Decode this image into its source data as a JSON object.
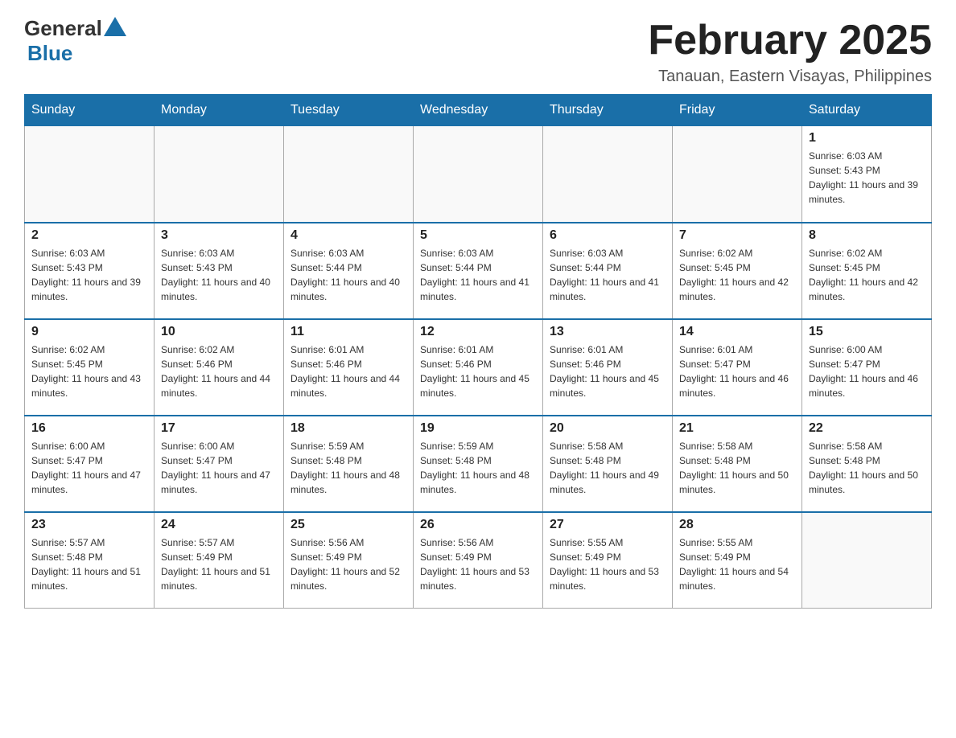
{
  "header": {
    "logo_general": "General",
    "logo_blue": "Blue",
    "title": "February 2025",
    "location": "Tanauan, Eastern Visayas, Philippines"
  },
  "weekdays": [
    "Sunday",
    "Monday",
    "Tuesday",
    "Wednesday",
    "Thursday",
    "Friday",
    "Saturday"
  ],
  "weeks": [
    [
      {
        "day": "",
        "sunrise": "",
        "sunset": "",
        "daylight": ""
      },
      {
        "day": "",
        "sunrise": "",
        "sunset": "",
        "daylight": ""
      },
      {
        "day": "",
        "sunrise": "",
        "sunset": "",
        "daylight": ""
      },
      {
        "day": "",
        "sunrise": "",
        "sunset": "",
        "daylight": ""
      },
      {
        "day": "",
        "sunrise": "",
        "sunset": "",
        "daylight": ""
      },
      {
        "day": "",
        "sunrise": "",
        "sunset": "",
        "daylight": ""
      },
      {
        "day": "1",
        "sunrise": "Sunrise: 6:03 AM",
        "sunset": "Sunset: 5:43 PM",
        "daylight": "Daylight: 11 hours and 39 minutes."
      }
    ],
    [
      {
        "day": "2",
        "sunrise": "Sunrise: 6:03 AM",
        "sunset": "Sunset: 5:43 PM",
        "daylight": "Daylight: 11 hours and 39 minutes."
      },
      {
        "day": "3",
        "sunrise": "Sunrise: 6:03 AM",
        "sunset": "Sunset: 5:43 PM",
        "daylight": "Daylight: 11 hours and 40 minutes."
      },
      {
        "day": "4",
        "sunrise": "Sunrise: 6:03 AM",
        "sunset": "Sunset: 5:44 PM",
        "daylight": "Daylight: 11 hours and 40 minutes."
      },
      {
        "day": "5",
        "sunrise": "Sunrise: 6:03 AM",
        "sunset": "Sunset: 5:44 PM",
        "daylight": "Daylight: 11 hours and 41 minutes."
      },
      {
        "day": "6",
        "sunrise": "Sunrise: 6:03 AM",
        "sunset": "Sunset: 5:44 PM",
        "daylight": "Daylight: 11 hours and 41 minutes."
      },
      {
        "day": "7",
        "sunrise": "Sunrise: 6:02 AM",
        "sunset": "Sunset: 5:45 PM",
        "daylight": "Daylight: 11 hours and 42 minutes."
      },
      {
        "day": "8",
        "sunrise": "Sunrise: 6:02 AM",
        "sunset": "Sunset: 5:45 PM",
        "daylight": "Daylight: 11 hours and 42 minutes."
      }
    ],
    [
      {
        "day": "9",
        "sunrise": "Sunrise: 6:02 AM",
        "sunset": "Sunset: 5:45 PM",
        "daylight": "Daylight: 11 hours and 43 minutes."
      },
      {
        "day": "10",
        "sunrise": "Sunrise: 6:02 AM",
        "sunset": "Sunset: 5:46 PM",
        "daylight": "Daylight: 11 hours and 44 minutes."
      },
      {
        "day": "11",
        "sunrise": "Sunrise: 6:01 AM",
        "sunset": "Sunset: 5:46 PM",
        "daylight": "Daylight: 11 hours and 44 minutes."
      },
      {
        "day": "12",
        "sunrise": "Sunrise: 6:01 AM",
        "sunset": "Sunset: 5:46 PM",
        "daylight": "Daylight: 11 hours and 45 minutes."
      },
      {
        "day": "13",
        "sunrise": "Sunrise: 6:01 AM",
        "sunset": "Sunset: 5:46 PM",
        "daylight": "Daylight: 11 hours and 45 minutes."
      },
      {
        "day": "14",
        "sunrise": "Sunrise: 6:01 AM",
        "sunset": "Sunset: 5:47 PM",
        "daylight": "Daylight: 11 hours and 46 minutes."
      },
      {
        "day": "15",
        "sunrise": "Sunrise: 6:00 AM",
        "sunset": "Sunset: 5:47 PM",
        "daylight": "Daylight: 11 hours and 46 minutes."
      }
    ],
    [
      {
        "day": "16",
        "sunrise": "Sunrise: 6:00 AM",
        "sunset": "Sunset: 5:47 PM",
        "daylight": "Daylight: 11 hours and 47 minutes."
      },
      {
        "day": "17",
        "sunrise": "Sunrise: 6:00 AM",
        "sunset": "Sunset: 5:47 PM",
        "daylight": "Daylight: 11 hours and 47 minutes."
      },
      {
        "day": "18",
        "sunrise": "Sunrise: 5:59 AM",
        "sunset": "Sunset: 5:48 PM",
        "daylight": "Daylight: 11 hours and 48 minutes."
      },
      {
        "day": "19",
        "sunrise": "Sunrise: 5:59 AM",
        "sunset": "Sunset: 5:48 PM",
        "daylight": "Daylight: 11 hours and 48 minutes."
      },
      {
        "day": "20",
        "sunrise": "Sunrise: 5:58 AM",
        "sunset": "Sunset: 5:48 PM",
        "daylight": "Daylight: 11 hours and 49 minutes."
      },
      {
        "day": "21",
        "sunrise": "Sunrise: 5:58 AM",
        "sunset": "Sunset: 5:48 PM",
        "daylight": "Daylight: 11 hours and 50 minutes."
      },
      {
        "day": "22",
        "sunrise": "Sunrise: 5:58 AM",
        "sunset": "Sunset: 5:48 PM",
        "daylight": "Daylight: 11 hours and 50 minutes."
      }
    ],
    [
      {
        "day": "23",
        "sunrise": "Sunrise: 5:57 AM",
        "sunset": "Sunset: 5:48 PM",
        "daylight": "Daylight: 11 hours and 51 minutes."
      },
      {
        "day": "24",
        "sunrise": "Sunrise: 5:57 AM",
        "sunset": "Sunset: 5:49 PM",
        "daylight": "Daylight: 11 hours and 51 minutes."
      },
      {
        "day": "25",
        "sunrise": "Sunrise: 5:56 AM",
        "sunset": "Sunset: 5:49 PM",
        "daylight": "Daylight: 11 hours and 52 minutes."
      },
      {
        "day": "26",
        "sunrise": "Sunrise: 5:56 AM",
        "sunset": "Sunset: 5:49 PM",
        "daylight": "Daylight: 11 hours and 53 minutes."
      },
      {
        "day": "27",
        "sunrise": "Sunrise: 5:55 AM",
        "sunset": "Sunset: 5:49 PM",
        "daylight": "Daylight: 11 hours and 53 minutes."
      },
      {
        "day": "28",
        "sunrise": "Sunrise: 5:55 AM",
        "sunset": "Sunset: 5:49 PM",
        "daylight": "Daylight: 11 hours and 54 minutes."
      },
      {
        "day": "",
        "sunrise": "",
        "sunset": "",
        "daylight": ""
      }
    ]
  ]
}
